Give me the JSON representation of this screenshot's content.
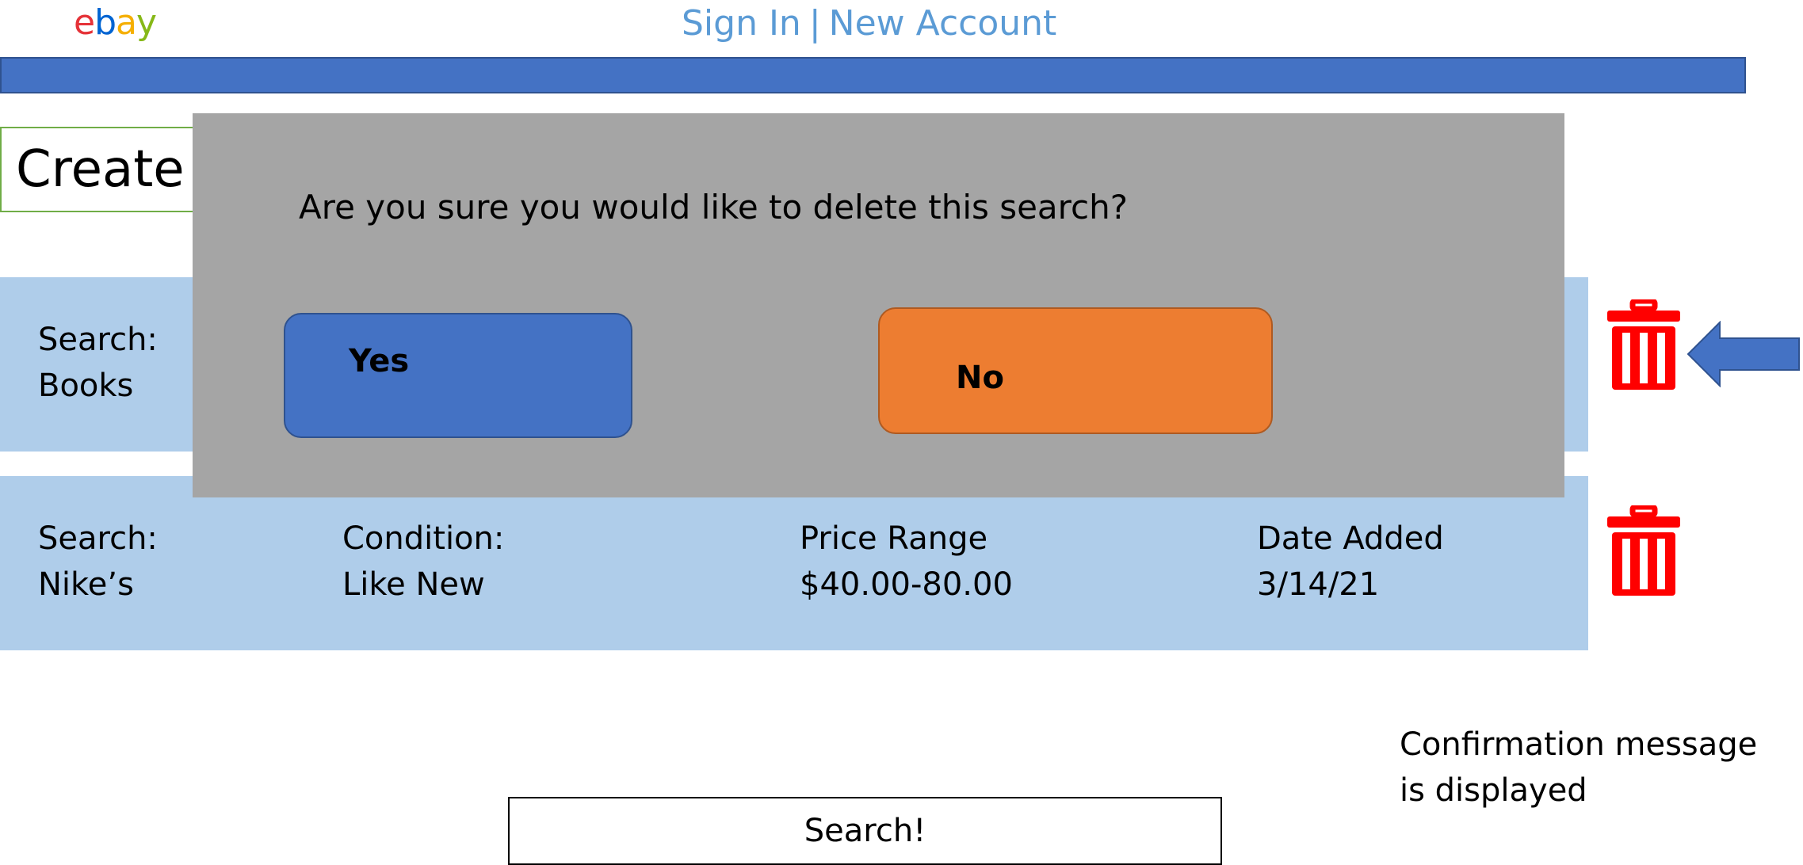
{
  "header": {
    "logo": {
      "letters": [
        "e",
        "b",
        "a",
        "y"
      ],
      "colors": [
        "#e53238",
        "#0064d2",
        "#f5af02",
        "#86b817"
      ]
    },
    "sign_in": "Sign In",
    "separator": "|",
    "new_account": "New Account",
    "bar_color": "#4472c4"
  },
  "create_button": {
    "label": "Create S"
  },
  "searches": [
    {
      "search_label": "Search:",
      "search_value": "Books",
      "trash_icon": "trash-icon"
    },
    {
      "search_label": "Search:",
      "search_value": "Nike’s",
      "condition_label": "Condition:",
      "condition_value": "Like New",
      "price_label": "Price Range",
      "price_value": "$40.00-80.00",
      "date_label": "Date Added",
      "date_value": "3/14/21",
      "trash_icon": "trash-icon"
    }
  ],
  "modal": {
    "message": "Are you sure you would like to delete this search?",
    "yes_label": "Yes",
    "no_label": "No",
    "background": "#a5a5a5",
    "yes_color": "#4472c4",
    "no_color": "#ed7d31"
  },
  "footer": {
    "search_button": "Search!"
  },
  "annotation": {
    "line1": "Confirmation message",
    "line2": "is displayed",
    "arrow_icon": "left-arrow-icon",
    "arrow_color": "#4472c4"
  }
}
